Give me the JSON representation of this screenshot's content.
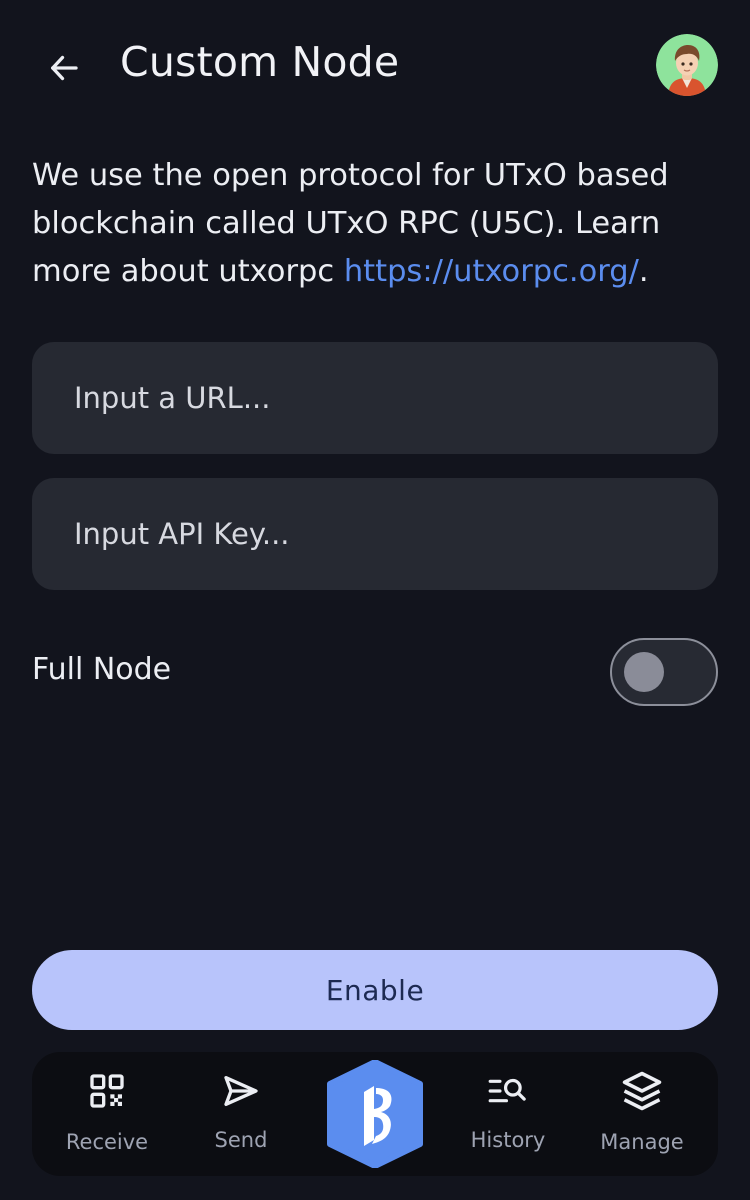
{
  "header": {
    "title": "Custom Node"
  },
  "description": {
    "text": "We use the open protocol for UTxO based blockchain called UTxO RPC (U5C). Learn more about utxorpc ",
    "link_text": "https://utxorpc.org/",
    "suffix": "."
  },
  "inputs": {
    "url_placeholder": "Input a URL...",
    "url_value": "",
    "api_key_placeholder": "Input API Key...",
    "api_key_value": ""
  },
  "full_node": {
    "label": "Full Node",
    "enabled": false
  },
  "enable_button": {
    "label": "Enable"
  },
  "bottom_nav": {
    "items": [
      {
        "label": "Receive",
        "icon": "qr-code-icon"
      },
      {
        "label": "Send",
        "icon": "send-icon"
      },
      {
        "label": "",
        "icon": "app-logo-icon"
      },
      {
        "label": "History",
        "icon": "history-search-icon"
      },
      {
        "label": "Manage",
        "icon": "layers-icon"
      }
    ]
  },
  "colors": {
    "background": "#12141d",
    "surface": "#262932",
    "link": "#5b8def",
    "primary_button": "#b8c4fb",
    "primary_button_text": "#1d2a52",
    "logo": "#5b8def",
    "nav_bar": "#0c0d12"
  }
}
